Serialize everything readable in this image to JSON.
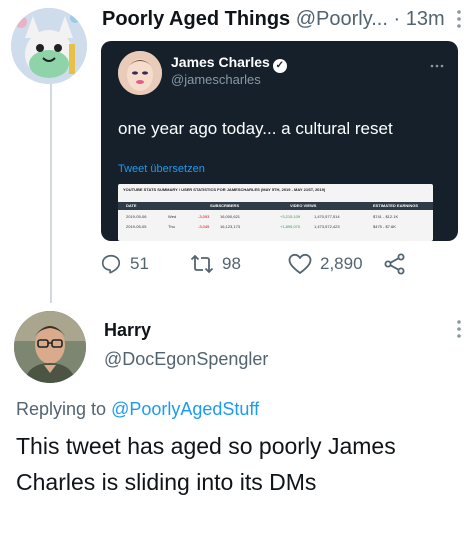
{
  "tweet": {
    "author_name": "Poorly Aged Things",
    "author_handle": "@Poorly...",
    "separator": "·",
    "time": "13m",
    "embedded": {
      "name": "James Charles",
      "handle": "@jamescharles",
      "text": "one year ago today... a cultural reset",
      "translate": "Tweet übersetzen",
      "stats_image": {
        "title": "YOUTUBE STATS SUMMARY / USER STATISTICS FOR JAMESCHARLES (MAY 5TH, 2019 - MAY 21ST, 2019)",
        "columns": [
          "DATE",
          "SUBSCRIBERS",
          "VIDEO VIEWS",
          "ESTIMATED EARNINGS"
        ],
        "rows": [
          [
            "2019-05-06",
            "Wed",
            "-3,093",
            "16,000,621",
            "+3,215,109",
            "1,470,577,514",
            "$741 - $12.1K"
          ],
          [
            "2019-05-05",
            "Thu",
            "-3,045",
            "16,123,173",
            "+1,895,070",
            "1,473,572,423",
            "$475 - $7.6K"
          ]
        ]
      }
    },
    "actions": {
      "replies": "51",
      "retweets": "98",
      "likes": "2,890"
    }
  },
  "reply": {
    "author_name": "Harry",
    "author_handle": "@DocEgonSpengler",
    "replying_prefix": "Replying to",
    "replying_to": "@PoorlyAgedStuff",
    "text": "This tweet has aged so poorly James Charles is sliding into its DMs"
  },
  "colors": {
    "link": "#1d9bf0",
    "secondary_text": "#536471",
    "embed_background": "#15202b"
  },
  "icons": [
    "more-vertical-icon",
    "verified-icon",
    "more-horizontal-icon",
    "reply-icon",
    "retweet-icon",
    "like-icon",
    "share-icon"
  ]
}
